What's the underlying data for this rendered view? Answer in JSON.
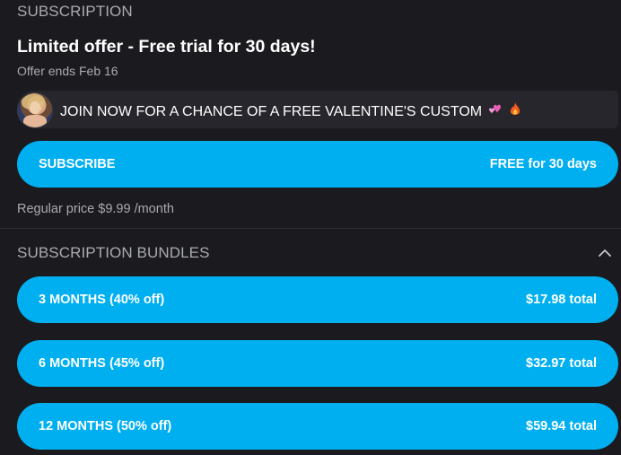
{
  "subscription": {
    "header": "SUBSCRIPTION",
    "offer_title": "Limited offer - Free trial for 30 days!",
    "offer_ends": "Offer ends Feb 16",
    "message": "JOIN NOW FOR A CHANCE OF A FREE VALENTINE'S CUSTOM",
    "subscribe_label": "SUBSCRIBE",
    "subscribe_price": "FREE for 30 days",
    "regular_price": "Regular price $9.99 /month"
  },
  "bundles": {
    "header": "SUBSCRIPTION BUNDLES",
    "items": [
      {
        "label": "3 MONTHS (40% off)",
        "price": "$17.98 total"
      },
      {
        "label": "6 MONTHS (45% off)",
        "price": "$32.97 total"
      },
      {
        "label": "12 MONTHS (50% off)",
        "price": "$59.94 total"
      }
    ]
  },
  "icons": {
    "avatar": "creator-avatar",
    "hearts": "two-hearts-icon",
    "fire": "fire-icon",
    "chevron": "chevron-up-icon"
  },
  "colors": {
    "background": "#1b1b1f",
    "accent": "#00aff0",
    "muted_text": "#a9abb0"
  }
}
